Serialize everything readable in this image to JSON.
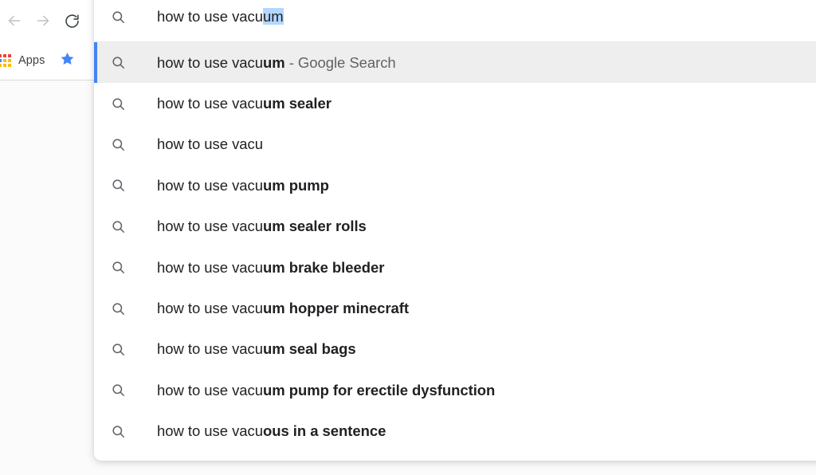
{
  "browser": {
    "nav": {
      "back_icon": "arrow-left-icon",
      "forward_icon": "arrow-right-icon",
      "reload_icon": "reload-icon"
    },
    "bookmarks": {
      "apps_label": "Apps",
      "apps_icon": "apps-grid-icon",
      "star_icon": "star-bookmark-icon"
    }
  },
  "omnibox": {
    "icon": "search-icon",
    "typed_text": "how to use vacu",
    "inline_autocomplete": "um",
    "full_value": "how to use vacuum",
    "selection_color": "#b3d7ff"
  },
  "suggestions": {
    "selected_index": 0,
    "highlight_bg": "#eeeeee",
    "accent_color": "#4285f4",
    "items": [
      {
        "icon": "search-icon",
        "prefix": "how to use vacu",
        "completion": "um",
        "description": " - Google Search",
        "selected": true
      },
      {
        "icon": "search-icon",
        "prefix": "how to use vacu",
        "completion": "um sealer",
        "description": "",
        "selected": false
      },
      {
        "icon": "search-icon",
        "prefix": "how to use vacu",
        "completion": "",
        "description": "",
        "selected": false
      },
      {
        "icon": "search-icon",
        "prefix": "how to use vacu",
        "completion": "um pump",
        "description": "",
        "selected": false
      },
      {
        "icon": "search-icon",
        "prefix": "how to use vacu",
        "completion": "um sealer rolls",
        "description": "",
        "selected": false
      },
      {
        "icon": "search-icon",
        "prefix": "how to use vacu",
        "completion": "um brake bleeder",
        "description": "",
        "selected": false
      },
      {
        "icon": "search-icon",
        "prefix": "how to use vacu",
        "completion": "um hopper minecraft",
        "description": "",
        "selected": false
      },
      {
        "icon": "search-icon",
        "prefix": "how to use vacu",
        "completion": "um seal bags",
        "description": "",
        "selected": false
      },
      {
        "icon": "search-icon",
        "prefix": "how to use vacu",
        "completion": "um pump for erectile dysfunction",
        "description": "",
        "selected": false
      },
      {
        "icon": "search-icon",
        "prefix": "how to use vacu",
        "completion": "ous in a sentence",
        "description": "",
        "selected": false
      }
    ]
  },
  "apps_grid_colors": [
    "#ea4335",
    "#ea4335",
    "#ea4335",
    "#4285f4",
    "#fbbc04",
    "#fbbc04",
    "#fbbc04",
    "#fbbc04",
    "#fbbc04"
  ]
}
